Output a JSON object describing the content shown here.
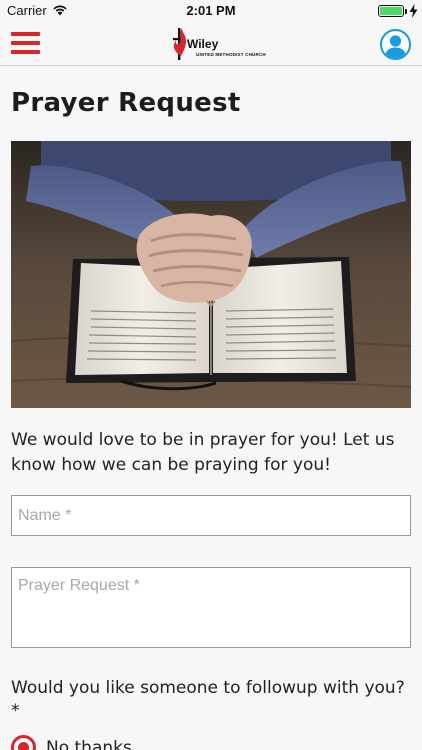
{
  "status_bar": {
    "carrier": "Carrier",
    "time": "2:01 PM"
  },
  "nav": {
    "logo_name": "Wiley",
    "logo_subtitle": "UNITED METHODIST CHURCH",
    "brand_color": "#d8262c",
    "avatar_color": "#1a9be0"
  },
  "page": {
    "title": "Prayer Request",
    "intro": "We would love to be in prayer for you!  Let us know how we can be praying for you!"
  },
  "form": {
    "name_placeholder": "Name *",
    "name_value": "",
    "request_placeholder": "Prayer Request *",
    "request_value": "",
    "followup_question": "Would you like someone to followup with you? *",
    "followup_options": [
      {
        "label": "No thanks",
        "selected": true
      }
    ]
  },
  "icons": [
    "menu-icon",
    "wifi-icon",
    "battery-icon",
    "charging-icon",
    "user-icon"
  ]
}
